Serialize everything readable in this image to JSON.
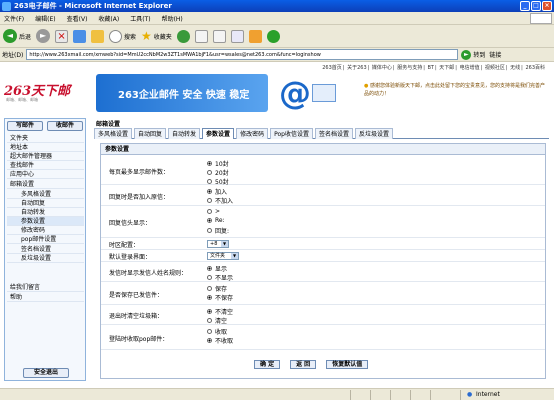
{
  "window": {
    "title": "263电子邮件 - Microsoft Internet Explorer"
  },
  "menubar": [
    "文件(F)",
    "编辑(E)",
    "查看(V)",
    "收藏(A)",
    "工具(T)",
    "帮助(H)"
  ],
  "toolbar": {
    "back": "后退",
    "search": "搜索",
    "favorites": "收藏夹"
  },
  "address": {
    "label": "地址(D)",
    "url": "http://www.263xmail.com/xmweb?sid=MmU2ccNbM2w3ZT1sMWA1bjF1&usr=wsales@net263.com&func=loginshow",
    "go": "转到",
    "links": "链接"
  },
  "topnav": [
    "263首页",
    "关于263",
    "媒体中心",
    "服务与支持",
    "BT",
    "天下邮",
    "电信增值",
    "视频社区",
    "无线",
    "263百科"
  ],
  "logo": {
    "text": "263天下邮",
    "sub": "邮箱、邮箱、邮箱"
  },
  "banner": {
    "text": "263企业邮件  安全 快速 稳定"
  },
  "notice": "感谢您体验新版天下邮，点击此处留下您的宝贵意见，您的支持将是我们完善产品的动力！",
  "leftnav": {
    "write": "写邮件",
    "receive": "收邮件",
    "items": [
      {
        "label": "文件夹",
        "kind": "hdr"
      },
      {
        "label": "地址本",
        "kind": "hdr"
      },
      {
        "label": "超大邮件管理器",
        "kind": "hdr"
      },
      {
        "label": "查找邮件",
        "kind": "hdr"
      },
      {
        "label": "应用中心",
        "kind": "hdr"
      },
      {
        "label": "邮箱设置",
        "kind": "hdr"
      },
      {
        "label": "多风格设置",
        "kind": "sub"
      },
      {
        "label": "自动回复",
        "kind": "sub"
      },
      {
        "label": "自动转发",
        "kind": "sub"
      },
      {
        "label": "参数设置",
        "kind": "sub-sel"
      },
      {
        "label": "修改密码",
        "kind": "sub"
      },
      {
        "label": "pop邮件设置",
        "kind": "sub"
      },
      {
        "label": "签名档设置",
        "kind": "sub"
      },
      {
        "label": "反垃圾设置",
        "kind": "sub"
      },
      {
        "label": "给我们留言",
        "kind": "hdr"
      },
      {
        "label": "帮助",
        "kind": "hdr"
      }
    ],
    "logout": "安全退出"
  },
  "main": {
    "title": "邮箱设置",
    "tabs": [
      "多风格设置",
      "自动回复",
      "自动转发",
      "参数设置",
      "修改密码",
      "Pop收信设置",
      "签名档设置",
      "反垃圾设置"
    ],
    "active_tab": "参数设置",
    "panel_title": "参数设置",
    "settings": [
      {
        "label": "每页最多显示邮件数：",
        "options": [
          "10封",
          "20封",
          "50封"
        ],
        "selected": 0
      },
      {
        "label": "回复时是否加入原信：",
        "options": [
          "加入",
          "不加入"
        ],
        "selected": 0
      },
      {
        "label": "回复信头显示：",
        "options": [
          ">",
          "Re:",
          "回复:"
        ],
        "selected": 1
      },
      {
        "label": "时区配置：",
        "value": "+8"
      },
      {
        "label": "默认登录界面：",
        "value": "文件夹"
      },
      {
        "label": "发信时显示发信人姓名规则：",
        "options": [
          "显示",
          "不显示"
        ],
        "selected": 0
      },
      {
        "label": "是否保存已发信件：",
        "options": [
          "保存",
          "不保存"
        ],
        "selected": 1
      },
      {
        "label": "退出时清空垃圾箱：",
        "options": [
          "不清空",
          "清空"
        ],
        "selected": 0
      },
      {
        "label": "登陆时收取pop邮件：",
        "options": [
          "收取",
          "不收取"
        ],
        "selected": 1
      }
    ],
    "buttons": [
      "确 定",
      "返 回",
      "恢复默认值"
    ]
  },
  "status": {
    "zone": "Internet"
  }
}
